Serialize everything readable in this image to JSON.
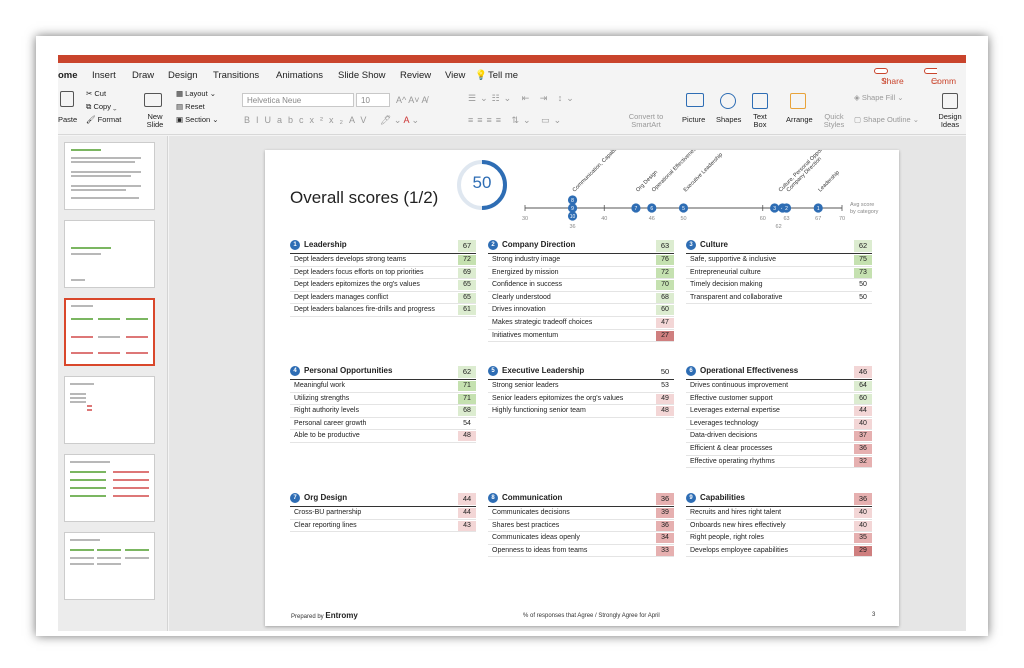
{
  "ribbon_tabs": [
    "ome",
    "Insert",
    "Draw",
    "Design",
    "Transitions",
    "Animations",
    "Slide Show",
    "Review",
    "View",
    "Tell me"
  ],
  "share_label": "Share",
  "comments_label": "Comm",
  "clipboard": {
    "paste": "Paste",
    "cut": "Cut",
    "copy": "Copy",
    "format": "Format"
  },
  "slides_group": {
    "new_slide": "New Slide",
    "layout": "Layout",
    "reset": "Reset",
    "section": "Section"
  },
  "font": {
    "name": "Helvetica Neue",
    "size": "10"
  },
  "convert_smartart": "Convert to SmartArt",
  "insert_group": {
    "picture": "Picture",
    "shapes": "Shapes",
    "text_box": "Text Box"
  },
  "arrange": "Arrange",
  "quick_styles": "Quick Styles",
  "shape_fill": "Shape Fill",
  "shape_outline": "Shape Outline",
  "design_ideas": "Design Ideas",
  "slide": {
    "title": "Overall scores (1/2)",
    "overall_score": "50",
    "axis": {
      "ticks": [
        "30",
        "40",
        "50",
        "60",
        "70"
      ],
      "avg_label": "Avg score by category"
    },
    "marker_values": [
      "36",
      "46",
      "63",
      "67",
      "62"
    ],
    "markers": [
      {
        "num": "8",
        "val": 36
      },
      {
        "num": "9",
        "val": 36
      },
      {
        "num": "10",
        "val": 36
      },
      {
        "num": "7",
        "val": 44
      },
      {
        "num": "6",
        "val": 46
      },
      {
        "num": "5",
        "val": 50
      },
      {
        "num": "3",
        "val": 62
      },
      {
        "num": "4",
        "val": 62
      },
      {
        "num": "2",
        "val": 63
      },
      {
        "num": "1",
        "val": 67
      }
    ],
    "marker_labels": [
      {
        "text": "Communication, Capabilities, Performance M.",
        "val": 36
      },
      {
        "text": "Org Design",
        "val": 44
      },
      {
        "text": "Operational Effectiveness",
        "val": 46
      },
      {
        "text": "Executive Leadership",
        "val": 50
      },
      {
        "text": "Culture, Personal Opportunities",
        "val": 62
      },
      {
        "text": "Company Direction",
        "val": 63
      },
      {
        "text": "Leadership",
        "val": 67
      }
    ],
    "categories": [
      {
        "num": "1",
        "name": "Leadership",
        "score": "67",
        "items": [
          [
            "Dept leaders develops strong teams",
            "72"
          ],
          [
            "Dept leaders focus efforts on top priorities",
            "69"
          ],
          [
            "Dept leaders epitomizes the org's values",
            "65"
          ],
          [
            "Dept leaders manages conflict",
            "65"
          ],
          [
            "Dept leaders balances fire-drills and progress",
            "61"
          ]
        ]
      },
      {
        "num": "2",
        "name": "Company Direction",
        "score": "63",
        "items": [
          [
            "Strong industry image",
            "76"
          ],
          [
            "Energized by mission",
            "72"
          ],
          [
            "Confidence in success",
            "70"
          ],
          [
            "Clearly understood",
            "68"
          ],
          [
            "Drives innovation",
            "60"
          ],
          [
            "Makes strategic tradeoff choices",
            "47"
          ],
          [
            "Initiatives momentum",
            "27"
          ]
        ]
      },
      {
        "num": "3",
        "name": "Culture",
        "score": "62",
        "items": [
          [
            "Safe, supportive & inclusive",
            "75"
          ],
          [
            "Entrepreneurial culture",
            "73"
          ],
          [
            "Timely decision making",
            "50"
          ],
          [
            "Transparent and collaborative",
            "50"
          ]
        ]
      },
      {
        "num": "4",
        "name": "Personal Opportunities",
        "score": "62",
        "items": [
          [
            "Meaningful work",
            "71"
          ],
          [
            "Utilizing strengths",
            "71"
          ],
          [
            "Right authority levels",
            "68"
          ],
          [
            "Personal career growth",
            "54"
          ],
          [
            "Able to be productive",
            "48"
          ]
        ]
      },
      {
        "num": "5",
        "name": "Executive Leadership",
        "score": "50",
        "items": [
          [
            "Strong senior leaders",
            "53"
          ],
          [
            "Senior leaders epitomizes the org's values",
            "49"
          ],
          [
            "Highly functioning senior team",
            "48"
          ]
        ]
      },
      {
        "num": "6",
        "name": "Operational Effectiveness",
        "score": "46",
        "items": [
          [
            "Drives continuous improvement",
            "64"
          ],
          [
            "Effective customer support",
            "60"
          ],
          [
            "Leverages external expertise",
            "44"
          ],
          [
            "Leverages technology",
            "40"
          ],
          [
            "Data-driven decisions",
            "37"
          ],
          [
            "Efficient & clear processes",
            "36"
          ],
          [
            "Effective operating rhythms",
            "32"
          ]
        ]
      },
      {
        "num": "7",
        "name": "Org Design",
        "score": "44",
        "items": [
          [
            "Cross-BU partnership",
            "44"
          ],
          [
            "Clear reporting lines",
            "43"
          ]
        ]
      },
      {
        "num": "8",
        "name": "Communication",
        "score": "36",
        "items": [
          [
            "Communicates decisions",
            "39"
          ],
          [
            "Shares best practices",
            "36"
          ],
          [
            "Communicates ideas openly",
            "34"
          ],
          [
            "Openness to ideas from teams",
            "33"
          ]
        ]
      },
      {
        "num": "9",
        "name": "Capabilities",
        "score": "36",
        "items": [
          [
            "Recruits and hires right talent",
            "40"
          ],
          [
            "Onboards new hires effectively",
            "40"
          ],
          [
            "Right people, right roles",
            "35"
          ],
          [
            "Develops employee capabilities",
            "29"
          ]
        ]
      }
    ],
    "footer": {
      "prepared_by": "Prepared by",
      "brand": "Entromy",
      "note": "% of responses that Agree / Strongly Agree for April",
      "page": "3"
    }
  }
}
